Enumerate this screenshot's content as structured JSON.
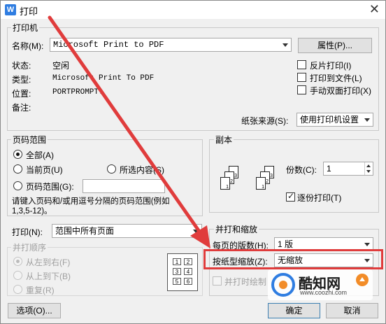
{
  "window": {
    "app_icon": "W",
    "title": "打印",
    "close": "✕"
  },
  "printer": {
    "group_title": "打印机",
    "name_label": "名称(M):",
    "name_value": "Microsoft Print to PDF",
    "properties_button": "属性(P)...",
    "status_label": "状态:",
    "status_value": "空闲",
    "type_label": "类型:",
    "type_value": "Microsoft Print To PDF",
    "location_label": "位置:",
    "location_value": "PORTPROMPT:",
    "comment_label": "备注:",
    "reverse_print": "反片打印(I)",
    "print_to_file": "打印到文件(L)",
    "manual_duplex": "手动双面打印(X)",
    "paper_source_label": "纸张来源(S):",
    "paper_source_value": "使用打印机设置"
  },
  "page_range": {
    "group_title": "页码范围",
    "all": "全部(A)",
    "current_page": "当前页(U)",
    "selection": "所选内容(S)",
    "pages": "页码范围(G):",
    "hint": "请键入页码和/或用逗号分隔的页码范围(例如",
    "hint_example": "1,3,5-12)。"
  },
  "copies": {
    "group_title": "副本",
    "count_label": "份数(C):",
    "count_value": "1",
    "collate": "逐份打印(T)",
    "page_nums": [
      "1",
      "2",
      "3"
    ]
  },
  "print_what": {
    "label": "打印(N):",
    "value": "范围中所有页面"
  },
  "collate_order": {
    "title": "并打顺序",
    "left_to_right": "从左到右(F)",
    "top_to_bottom": "从上到下(B)",
    "repeat": "重复(R)",
    "grid_nums": [
      "1",
      "2",
      "3",
      "4",
      "5",
      "6"
    ]
  },
  "zoom": {
    "group_title": "并打和缩放",
    "pages_per_sheet_label": "每页的版数(H):",
    "pages_per_sheet_value": "1 版",
    "scale_label": "按纸型缩放(Z):",
    "scale_value": "无缩放",
    "draw_border": "并打时绘制"
  },
  "buttons": {
    "options": "选项(O)...",
    "ok": "确定",
    "cancel": "取消"
  },
  "watermark": {
    "brand": "酷知网",
    "url": "www.coozhi.com"
  },
  "colors": {
    "arrow": "#e03c3c",
    "highlight": "#e03c3c",
    "accent": "#2f7de1"
  }
}
